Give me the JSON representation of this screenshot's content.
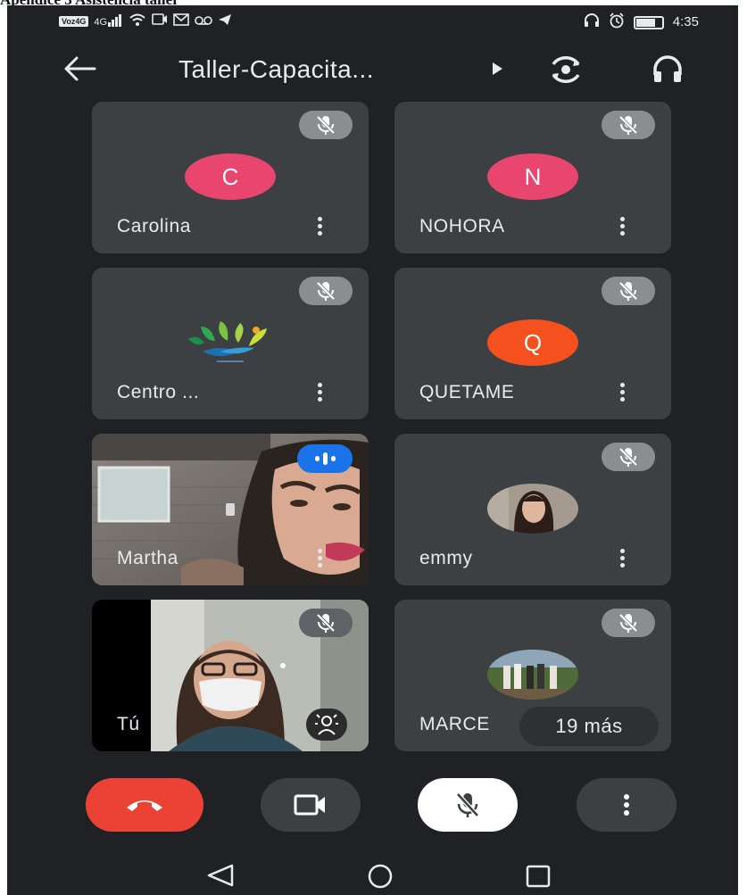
{
  "caption": "Apéndice 3 Asistencia taller",
  "status_bar": {
    "carrier_badge": "Voz4G",
    "signal_label": "4G",
    "time": "4:35",
    "icons": [
      "signal-icon",
      "wifi-icon",
      "cast-icon",
      "gmail-icon",
      "voicemail-icon",
      "telegram-icon",
      "headset-icon",
      "alarm-icon",
      "battery-icon"
    ],
    "battery_level": 0.7
  },
  "top_bar": {
    "title": "Taller-Capacita...",
    "icons": [
      "back-arrow-icon",
      "play-icon",
      "flip-camera-icon",
      "headphones-icon"
    ]
  },
  "participants": [
    {
      "name": "Carolina",
      "initial": "C",
      "avatar_color": "#e8456f",
      "muted": true
    },
    {
      "name": "NOHORA",
      "initial": "N",
      "avatar_color": "#e8456f",
      "muted": true
    },
    {
      "name": "Centro ...",
      "logo": "leaf-logo",
      "muted": true
    },
    {
      "name": "QUETAME",
      "initial": "Q",
      "avatar_color": "#f4511e",
      "muted": true
    },
    {
      "name": "Martha",
      "video": true,
      "speaking": true
    },
    {
      "name": "emmy",
      "photo": true,
      "muted": true
    },
    {
      "name": "Tú",
      "video": true,
      "muted": true
    },
    {
      "name": "MARCE",
      "photo": true,
      "muted": true
    }
  ],
  "more_participants": "19 más",
  "controls": [
    "hang-up-button",
    "camera-button",
    "mic-muted-button",
    "more-options-button"
  ],
  "colors": {
    "background": "#202124",
    "tile": "#3c4043",
    "hangup": "#ea4335",
    "speaking": "#1a73e8"
  }
}
